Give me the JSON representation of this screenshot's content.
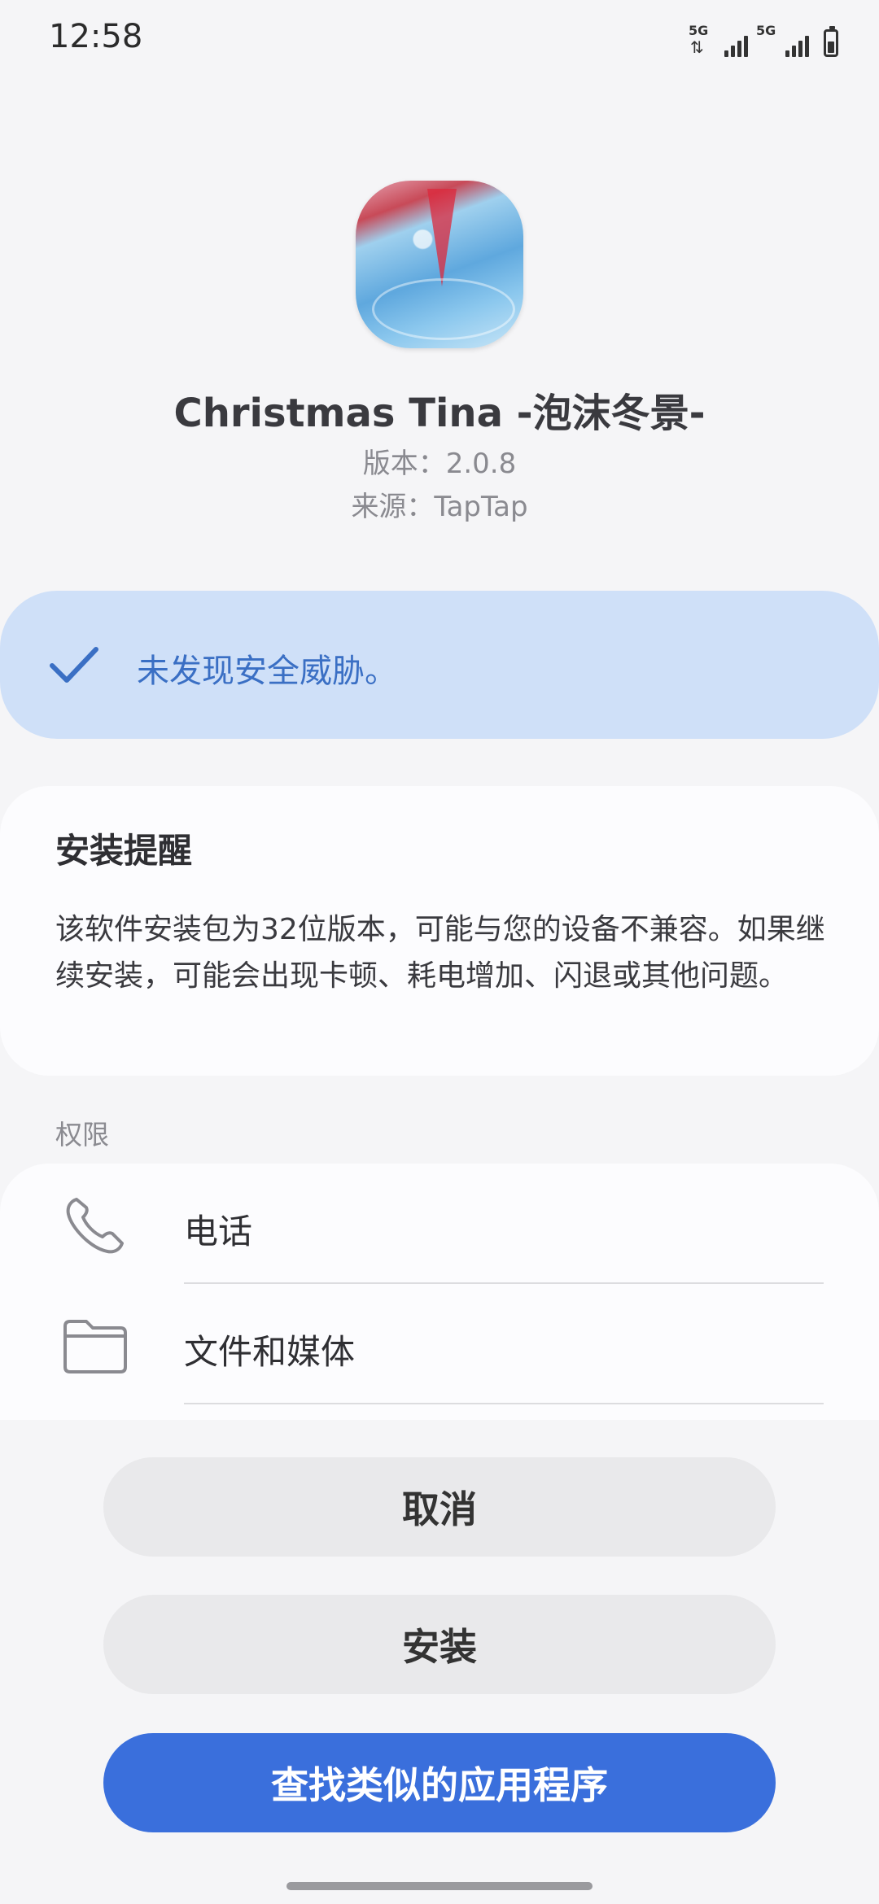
{
  "status_bar": {
    "time": "12:58",
    "network_label_1": "5G",
    "network_label_2": "5G",
    "battery_level": 0.45
  },
  "app": {
    "name": "Christmas Tina -泡沫冬景-",
    "version": "版本：2.0.8",
    "source": "来源：TapTap"
  },
  "security": {
    "message": "未发现安全威胁。",
    "icon": "check-icon"
  },
  "reminder": {
    "title": "安装提醒",
    "body": "该软件安装包为32位版本，可能与您的设备不兼容。如果继续安装，可能会出现卡顿、耗电增加、闪退或其他问题。"
  },
  "permissions": {
    "label": "权限",
    "items": [
      {
        "label": "电话",
        "icon": "phone-icon"
      },
      {
        "label": "文件和媒体",
        "icon": "folder-icon"
      }
    ]
  },
  "buttons": {
    "cancel": "取消",
    "install": "安装",
    "find_similar": "查找类似的应用程序"
  },
  "colors": {
    "accent": "#3a6fdc",
    "security_bg": "#cfe0f8",
    "security_text": "#3a6fc4"
  }
}
